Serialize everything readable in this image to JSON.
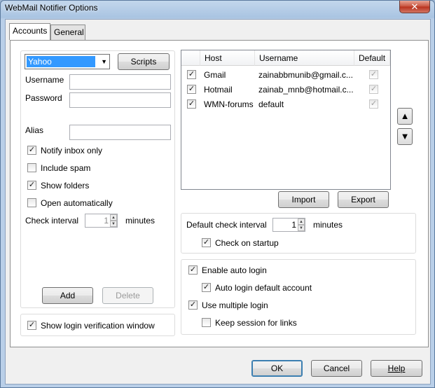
{
  "window": {
    "title": "WebMail Notifier Options"
  },
  "tabs": [
    {
      "label": "Accounts",
      "active": true
    },
    {
      "label": "General",
      "active": false
    }
  ],
  "account_form": {
    "provider": "Yahoo",
    "scripts_label": "Scripts",
    "username_label": "Username",
    "username_value": "",
    "password_label": "Password",
    "password_value": "",
    "alias_label": "Alias",
    "alias_value": "",
    "options": [
      {
        "label": "Notify inbox only",
        "checked": true
      },
      {
        "label": "Include spam",
        "checked": false
      },
      {
        "label": "Show folders",
        "checked": true
      },
      {
        "label": "Open automatically",
        "checked": false
      }
    ],
    "check_interval_label": "Check interval",
    "check_interval_value": "1",
    "minutes_label": "minutes",
    "add_label": "Add",
    "delete_label": "Delete"
  },
  "show_login_verification": {
    "label": "Show login verification window",
    "checked": true
  },
  "accounts_table": {
    "columns": [
      "Host",
      "Username",
      "Default"
    ],
    "rows": [
      {
        "checked": true,
        "host": "Gmail",
        "username": "zainabbmunib@gmail.c...",
        "default": true
      },
      {
        "checked": true,
        "host": "Hotmail",
        "username": "zainab_mnb@hotmail.c...",
        "default": true
      },
      {
        "checked": true,
        "host": "WMN-forums",
        "username": "default",
        "default": true
      }
    ]
  },
  "move_up_icon": "triangle-up-icon",
  "move_down_icon": "triangle-down-icon",
  "import_label": "Import",
  "export_label": "Export",
  "default_interval": {
    "label": "Default check interval",
    "value": "1",
    "minutes_label": "minutes",
    "check_on_startup": {
      "label": "Check on startup",
      "checked": true
    }
  },
  "login_options": [
    {
      "label": "Enable auto login",
      "checked": true
    },
    {
      "label": "Auto login default account",
      "checked": true
    },
    {
      "label": "Use multiple login",
      "checked": true
    },
    {
      "label": "Keep session for links",
      "checked": false
    }
  ],
  "footer": {
    "ok_label": "OK",
    "cancel_label": "Cancel",
    "help_label": "Help"
  },
  "colors": {
    "selection": "#3399ff",
    "title_bar": "#b9cfe8",
    "close_button": "#c7503b"
  }
}
